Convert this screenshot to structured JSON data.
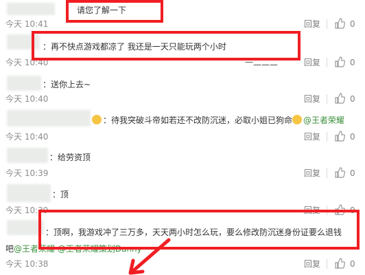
{
  "comments": [
    {
      "text": "请您了解一下",
      "time": "今天 10:41",
      "count": "0"
    },
    {
      "text": "：再不快点游戏都凉了 我还是一天只能玩两个小时",
      "time": "今天 10:40",
      "count": "0"
    },
    {
      "text": "：送你上去~",
      "time": "今天 10:40",
      "count": "0"
    },
    {
      "text": "：待我突破斗帝如若还不改防沉迷，必取小姐已狗命",
      "mention": "@王者荣耀",
      "time": "今天 10:40",
      "count": "0"
    },
    {
      "text": "：给劳资顶",
      "time": "今天 10:39",
      "count": "0"
    },
    {
      "text": "：顶",
      "time": "今天 10:39",
      "count": "0"
    },
    {
      "text": "：顶啊，我游戏冲了三万多，天天两小时怎么玩，要么修改防沉迷身份证要么退钱",
      "prefix": "吧",
      "mention": "@王者荣耀",
      "mention2": "@王者荣耀策划Danny",
      "time": "今天 10:38",
      "count": "0"
    }
  ],
  "reply_label": "回复",
  "partial_text": "一二二二",
  "icons": {
    "like": "thumbs-up-icon",
    "emoji": "emoji-icon"
  },
  "colors": {
    "highlight": "#f01e23",
    "mention": "#3a8e3a",
    "time": "#8c8c8c"
  }
}
